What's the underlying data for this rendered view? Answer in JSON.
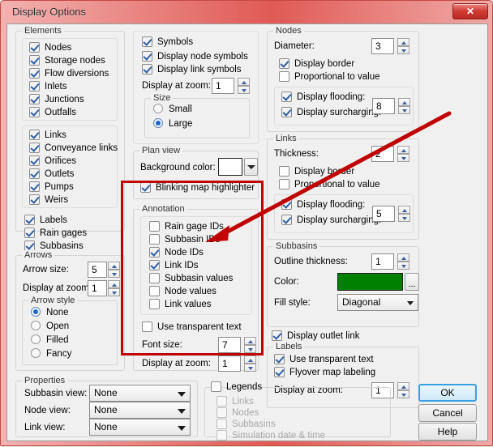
{
  "window": {
    "title": "Display Options",
    "close_label": "✕",
    "accent_color": "#c00000",
    "titlebar_color": "#e05a55"
  },
  "elements": {
    "group_label": "Elements",
    "nodes_panel": [
      {
        "label": "Nodes",
        "checked": true
      },
      {
        "label": "Storage nodes",
        "checked": true
      },
      {
        "label": "Flow diversions",
        "checked": true
      },
      {
        "label": "Inlets",
        "checked": true
      },
      {
        "label": "Junctions",
        "checked": true
      },
      {
        "label": "Outfalls",
        "checked": true
      }
    ],
    "links_panel": [
      {
        "label": "Links",
        "checked": true
      },
      {
        "label": "Conveyance links",
        "checked": true
      },
      {
        "label": "Orifices",
        "checked": true
      },
      {
        "label": "Outlets",
        "checked": true
      },
      {
        "label": "Pumps",
        "checked": true
      },
      {
        "label": "Weirs",
        "checked": true
      }
    ],
    "misc": [
      {
        "label": "Labels",
        "checked": true
      },
      {
        "label": "Rain gages",
        "checked": true
      },
      {
        "label": "Subbasins",
        "checked": true
      }
    ]
  },
  "arrows": {
    "group_label": "Arrows",
    "arrow_size_label": "Arrow size:",
    "arrow_size_value": "5",
    "display_zoom_label": "Display at zoom:",
    "display_zoom_value": "1",
    "style_label": "Arrow style",
    "styles": [
      {
        "label": "None",
        "selected": true
      },
      {
        "label": "Open",
        "selected": false
      },
      {
        "label": "Filled",
        "selected": false
      },
      {
        "label": "Fancy",
        "selected": false
      }
    ]
  },
  "properties": {
    "group_label": "Properties",
    "rows": [
      {
        "label": "Subbasin view:",
        "value": "None"
      },
      {
        "label": "Node view:",
        "value": "None"
      },
      {
        "label": "Link view:",
        "value": "None"
      }
    ]
  },
  "symbols": {
    "items": [
      {
        "label": "Symbols",
        "checked": true
      },
      {
        "label": "Display node symbols",
        "checked": true
      },
      {
        "label": "Display link symbols",
        "checked": true
      }
    ],
    "display_zoom_label": "Display at zoom:",
    "display_zoom_value": "1",
    "size_label": "Size",
    "sizes": [
      {
        "label": "Small",
        "selected": false
      },
      {
        "label": "Large",
        "selected": true
      }
    ]
  },
  "plan_view": {
    "group_label": "Plan view",
    "background_color_label": "Background color:",
    "background_color_value": "#ffffff",
    "blinking_label": "Blinking map highlighter",
    "blinking_checked": true
  },
  "annotation": {
    "group_label": "Annotation",
    "items": [
      {
        "label": "Rain gage IDs",
        "checked": false
      },
      {
        "label": "Subbasin IDs",
        "checked": false
      },
      {
        "label": "Node IDs",
        "checked": true
      },
      {
        "label": "Link IDs",
        "checked": true
      },
      {
        "label": "Subbasin values",
        "checked": false
      },
      {
        "label": "Node values",
        "checked": false
      },
      {
        "label": "Link values",
        "checked": false
      }
    ],
    "transparent_label": "Use transparent text",
    "transparent_checked": false,
    "font_size_label": "Font size:",
    "font_size_value": "7",
    "display_zoom_label": "Display at zoom:",
    "display_zoom_value": "1"
  },
  "nodes": {
    "group_label": "Nodes",
    "diameter_label": "Diameter:",
    "diameter_value": "3",
    "display_border_label": "Display border",
    "display_border_checked": true,
    "proportional_label": "Proportional to value",
    "proportional_checked": false,
    "flooding_label": "Display flooding:",
    "flooding_checked": true,
    "surcharging_label": "Display surcharging:",
    "surcharging_checked": true,
    "surcharge_value": "8"
  },
  "links": {
    "group_label": "Links",
    "thickness_label": "Thickness:",
    "thickness_value": "2",
    "display_border_label": "Display border",
    "display_border_checked": false,
    "proportional_label": "Proportional to value",
    "proportional_checked": false,
    "flooding_label": "Display flooding:",
    "flooding_checked": true,
    "surcharging_label": "Display surcharging:",
    "surcharging_checked": true,
    "surcharge_value": "5"
  },
  "subbasins": {
    "group_label": "Subbasins",
    "outline_label": "Outline thickness:",
    "outline_value": "1",
    "color_label": "Color:",
    "color_value": "#008000",
    "color_browse_label": "...",
    "fill_style_label": "Fill style:",
    "fill_style_value": "Diagonal",
    "outlet_link_label": "Display outlet link",
    "outlet_link_checked": true
  },
  "labels": {
    "group_label": "Labels",
    "transparent_label": "Use transparent text",
    "transparent_checked": true,
    "flyover_label": "Flyover map labeling",
    "flyover_checked": true,
    "display_zoom_label": "Display at zoom:",
    "display_zoom_value": "1"
  },
  "legends": {
    "group_label": "Legends",
    "checked": false,
    "items": [
      {
        "label": "Links",
        "checked": false,
        "disabled": true
      },
      {
        "label": "Nodes",
        "checked": false,
        "disabled": true
      },
      {
        "label": "Subbasins",
        "checked": false,
        "disabled": true
      },
      {
        "label": "Simulation date & time",
        "checked": false,
        "disabled": true
      }
    ]
  },
  "buttons": {
    "ok": "OK",
    "cancel": "Cancel",
    "help": "Help"
  }
}
